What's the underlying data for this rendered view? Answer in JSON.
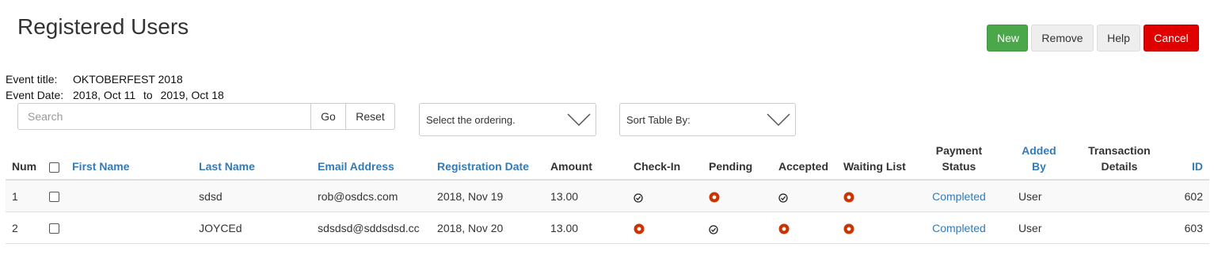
{
  "page": {
    "title": "Registered Users"
  },
  "toolbar": {
    "new": "New",
    "remove": "Remove",
    "help": "Help",
    "cancel": "Cancel"
  },
  "event": {
    "title_label": "Event title:",
    "title": "OKTOBERFEST 2018",
    "date_label": "Event Date:",
    "date_from": "2018, Oct 11",
    "to": "to",
    "date_to": "2019, Oct 18"
  },
  "search": {
    "placeholder": "Search",
    "value": "",
    "go": "Go",
    "reset": "Reset"
  },
  "ordering": {
    "placeholder": "Select the ordering."
  },
  "sort": {
    "placeholder": "Sort Table By:"
  },
  "table": {
    "headers": {
      "num": "Num",
      "first_name": "First Name",
      "last_name": "Last Name",
      "email": "Email Address",
      "reg_date": "Registration Date",
      "amount": "Amount",
      "checkin": "Check-In",
      "pending": "Pending",
      "accepted": "Accepted",
      "waiting": "Waiting List",
      "payment_line1": "Payment",
      "payment_line2": "Status",
      "added_line1": "Added",
      "added_line2": "By",
      "trans_line1": "Transaction",
      "trans_line2": "Details",
      "id": "ID"
    },
    "rows": [
      {
        "num": "1",
        "first_name": "",
        "last_name": "sdsd",
        "email": "rob@osdcs.com",
        "reg_date": "2018, Nov 19",
        "amount": "13.00",
        "checkin": "check",
        "pending": "circle",
        "accepted": "check",
        "waiting": "circle",
        "payment_status": "Completed",
        "added_by": "User",
        "transaction": "",
        "id": "602"
      },
      {
        "num": "2",
        "first_name": "",
        "last_name": "JOYCEd",
        "email": "sdsdsd@sddsdsd.cc",
        "reg_date": "2018, Nov 20",
        "amount": "13.00",
        "checkin": "circle",
        "pending": "check",
        "accepted": "circle",
        "waiting": "circle",
        "payment_status": "Completed",
        "added_by": "User",
        "transaction": "",
        "id": "603"
      }
    ]
  },
  "colors": {
    "accent": "#337ab7",
    "success": "#4aa84a",
    "danger": "#e10000",
    "status_circle": "#cc3300"
  },
  "icons": {
    "check": "check-circle-icon",
    "circle": "radio-circle-icon"
  }
}
